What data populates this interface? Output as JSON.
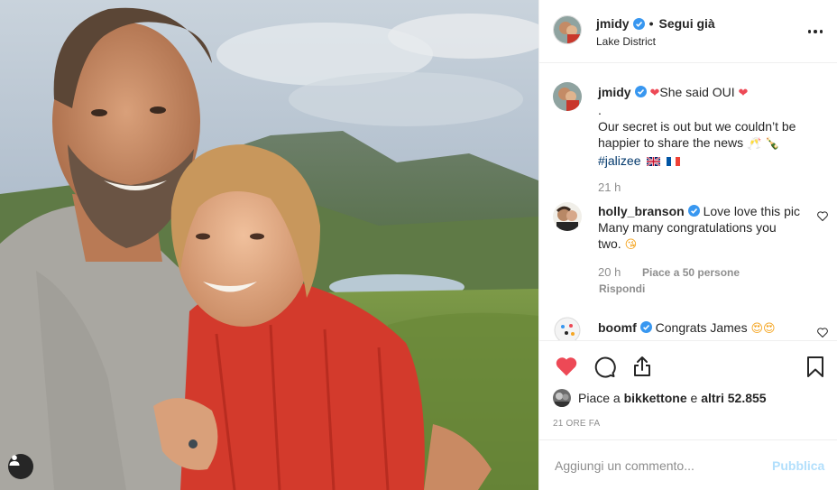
{
  "post": {
    "author": "jmidy",
    "follow_status": "Segui già",
    "location": "Lake District",
    "separator": "•"
  },
  "caption": {
    "username": "jmidy",
    "line1": "She said OUI",
    "line2": ".",
    "line3": "Our secret is out but we couldn’t be",
    "line4": "happier to share the news",
    "hashtag": "#jalizee",
    "time": "21 h"
  },
  "comments": [
    {
      "username": "holly_branson",
      "line1": "Love love this pic.",
      "line2": "Many many congratulations you",
      "line3": "two.",
      "time": "20 h",
      "likes": "Piace a 50 persone",
      "reply": "Rispondi"
    },
    {
      "username": "boomf",
      "text": "Congrats James"
    }
  ],
  "likes": {
    "prefix": "Piace a",
    "user": "bikkettone",
    "conjunction": "e",
    "others": "altri 52.855"
  },
  "timestamp": "21 ORE FA",
  "comment_box": {
    "placeholder": "Aggiungi un commento...",
    "publish": "Pubblica"
  },
  "colors": {
    "verified": "#3897f0",
    "like_active": "#ed4956",
    "publish_disabled": "#b2dffc",
    "hashtag": "#00376b"
  },
  "icons": {
    "verified": "verified-badge-icon",
    "like": "heart-filled-icon",
    "comment": "comment-bubble-icon",
    "share": "share-icon",
    "save": "bookmark-icon",
    "more": "more-options-icon",
    "tags": "user-tag-icon"
  }
}
